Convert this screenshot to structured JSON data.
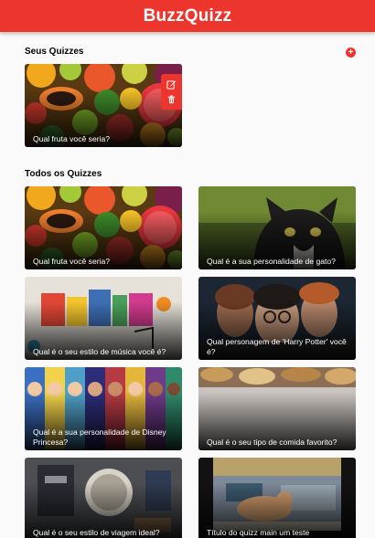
{
  "header": {
    "title": "BuzzQuizz"
  },
  "your_quizzes": {
    "title": "Seus Quizzes",
    "add_icon": "plus-circle-icon",
    "items": [
      {
        "title": "Qual fruta você seria?",
        "image": "fruits"
      }
    ],
    "actions": {
      "edit_icon": "edit-icon",
      "delete_icon": "trash-icon"
    }
  },
  "all_quizzes": {
    "title": "Todos os Quizzes",
    "items": [
      {
        "title": "Qual fruta você seria?",
        "image": "fruits"
      },
      {
        "title": "Qual é a sua personalidade de gato?",
        "image": "cat"
      },
      {
        "title": "Qual é o seu estilo de música você é?",
        "image": "music"
      },
      {
        "title": "Qual personagem de 'Harry Potter' você é?",
        "image": "harry-potter"
      },
      {
        "title": "Qual é a sua personalidade de Disney Princesa?",
        "image": "disney-princesses"
      },
      {
        "title": "Qual é o seu tipo de comida favorito?",
        "image": "food"
      },
      {
        "title": "Qual é o seu estilo de viagem ideal?",
        "image": "travel"
      },
      {
        "title": "Título do quizz main um teste",
        "image": "cat-on-bed"
      }
    ]
  },
  "colors": {
    "accent": "#ec362d",
    "background": "#fafafa"
  }
}
